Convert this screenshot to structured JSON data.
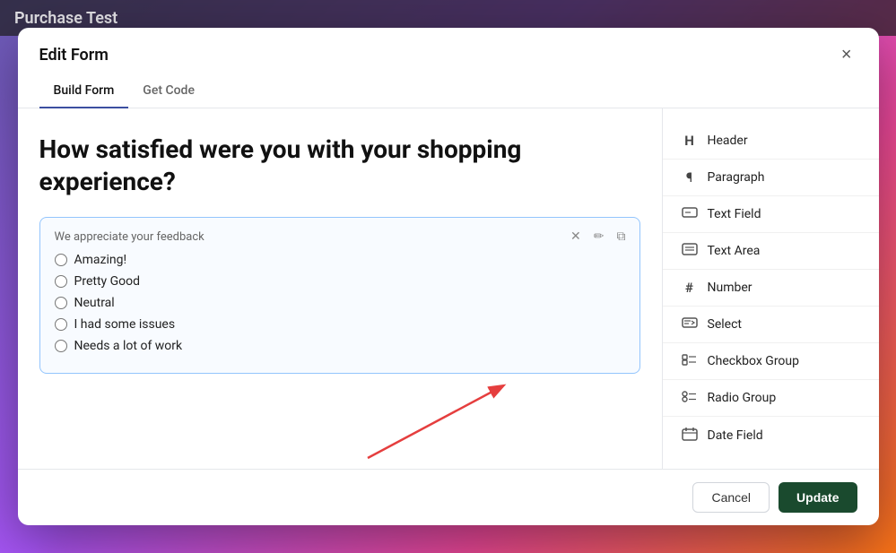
{
  "background": {
    "title": "Purchase Test"
  },
  "modal": {
    "title": "Edit Form",
    "close_label": "×",
    "tabs": [
      {
        "id": "build",
        "label": "Build Form",
        "active": true
      },
      {
        "id": "code",
        "label": "Get Code",
        "active": false
      }
    ],
    "form": {
      "heading": "How satisfied were you with your shopping experience?",
      "radio_group": {
        "placeholder": "We appreciate your feedback",
        "options": [
          "Amazing!",
          "Pretty Good",
          "Neutral",
          "I had some issues",
          "Needs a lot of work"
        ]
      },
      "box_actions": {
        "delete": "×",
        "edit": "✏",
        "copy": "⧉"
      }
    },
    "toolbar": {
      "items": [
        {
          "id": "header",
          "icon": "H",
          "label": "Header"
        },
        {
          "id": "paragraph",
          "icon": "¶",
          "label": "Paragraph"
        },
        {
          "id": "text-field",
          "icon": "▭",
          "label": "Text Field"
        },
        {
          "id": "text-area",
          "icon": "▬",
          "label": "Text Area"
        },
        {
          "id": "number",
          "icon": "#",
          "label": "Number"
        },
        {
          "id": "select",
          "icon": "☰",
          "label": "Select"
        },
        {
          "id": "checkbox-group",
          "icon": "☰",
          "label": "Checkbox Group"
        },
        {
          "id": "radio-group",
          "icon": "☰",
          "label": "Radio Group"
        },
        {
          "id": "date-field",
          "icon": "📅",
          "label": "Date Field"
        }
      ]
    },
    "footer": {
      "cancel_label": "Cancel",
      "update_label": "Update"
    }
  }
}
